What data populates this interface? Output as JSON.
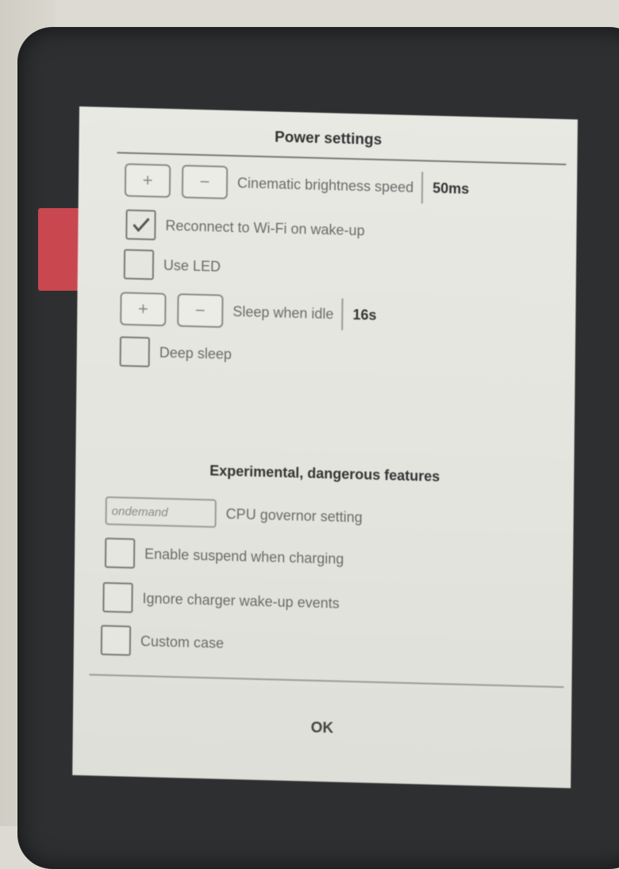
{
  "dialog": {
    "title": "Power settings",
    "ok_label": "OK"
  },
  "power": {
    "brightness_speed": {
      "plus_label": "+",
      "minus_label": "−",
      "label": "Cinematic brightness speed",
      "value": "50ms"
    },
    "reconnect_wifi": {
      "label": "Reconnect to Wi-Fi on wake-up",
      "checked": true
    },
    "use_led": {
      "label": "Use LED",
      "checked": false
    },
    "sleep_idle": {
      "plus_label": "+",
      "minus_label": "−",
      "label": "Sleep when idle",
      "value": "16s"
    },
    "deep_sleep": {
      "label": "Deep sleep",
      "checked": false
    }
  },
  "experimental": {
    "title": "Experimental, dangerous features",
    "cpu_governor": {
      "value": "ondemand",
      "label": "CPU governor setting"
    },
    "suspend_charging": {
      "label": "Enable suspend when charging",
      "checked": false
    },
    "ignore_charger": {
      "label": "Ignore charger wake-up events",
      "checked": false
    },
    "custom_case": {
      "label": "Custom case",
      "checked": false
    }
  },
  "colors": {
    "device_bezel": "#2e2f31",
    "screen": "#e6e6e1",
    "accent_tab": "#c9474f"
  }
}
